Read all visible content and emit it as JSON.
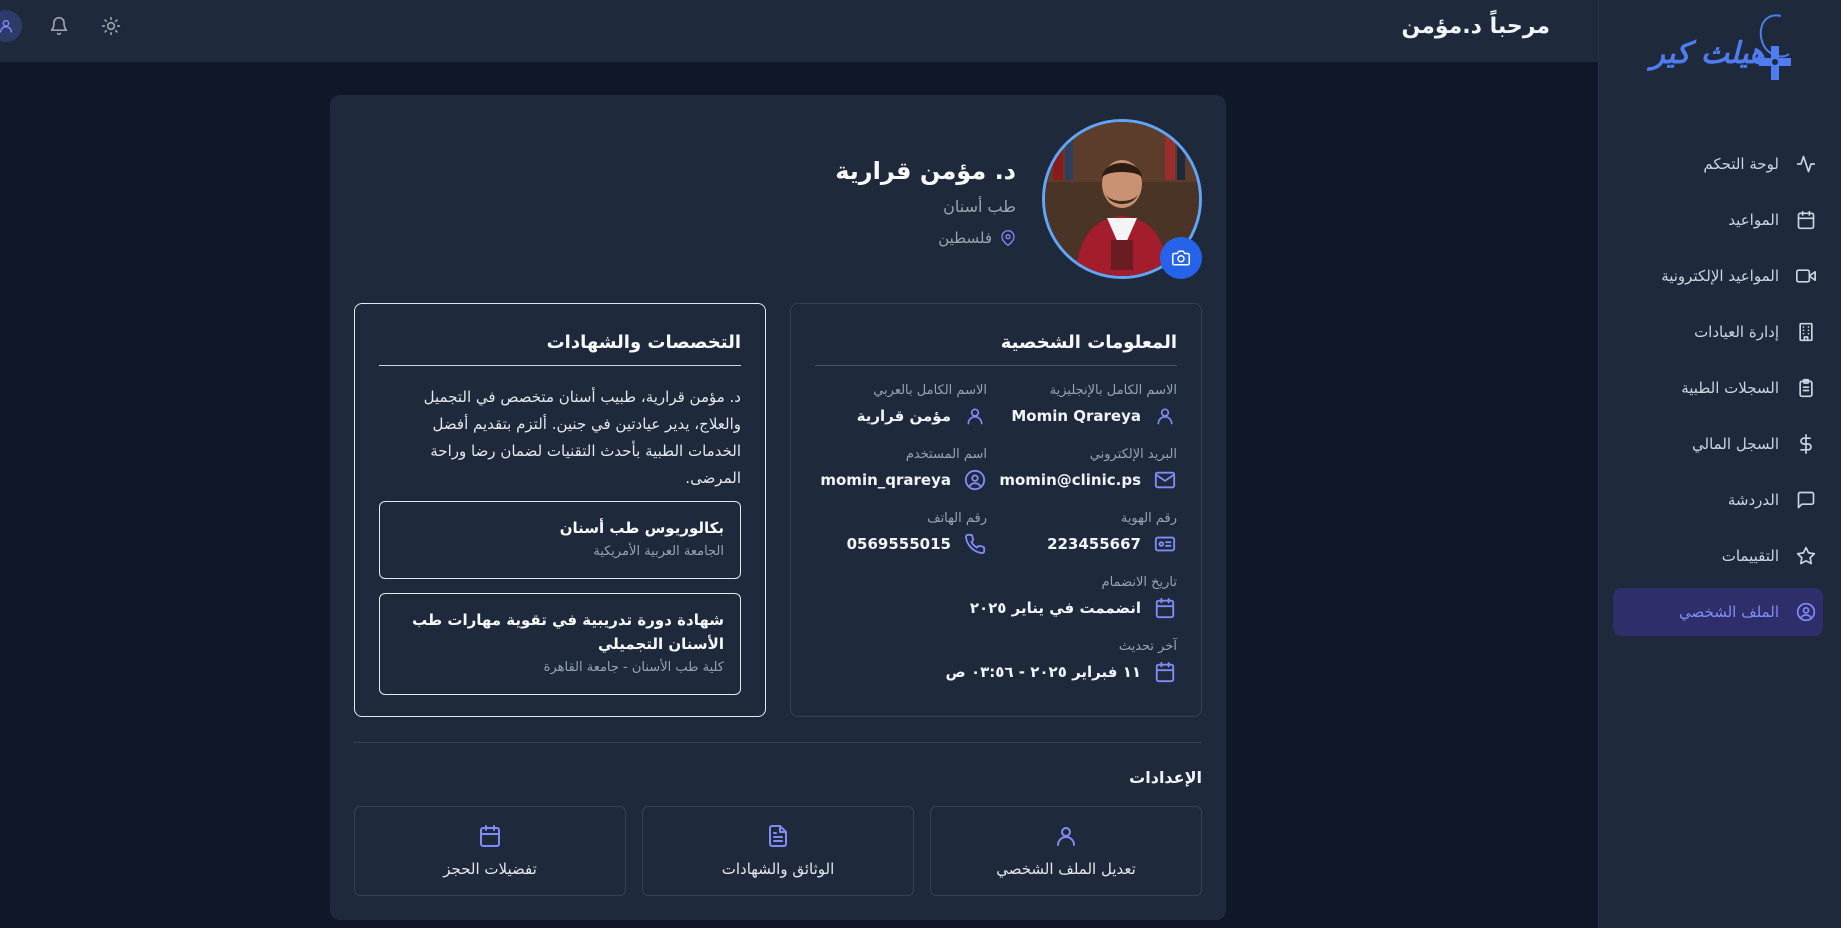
{
  "sidebar": {
    "logo_text": "هيلث كير",
    "items": [
      {
        "label": "لوحة التحكم",
        "icon": "activity-icon"
      },
      {
        "label": "المواعيد",
        "icon": "calendar-icon"
      },
      {
        "label": "المواعيد الإلكترونية",
        "icon": "video-icon"
      },
      {
        "label": "إدارة العيادات",
        "icon": "building-icon"
      },
      {
        "label": "السجلات الطبية",
        "icon": "clipboard-icon"
      },
      {
        "label": "السجل المالي",
        "icon": "dollar-icon"
      },
      {
        "label": "الدردشة",
        "icon": "chat-icon"
      },
      {
        "label": "التقييمات",
        "icon": "star-icon"
      },
      {
        "label": "الملف الشخصي",
        "icon": "user-circle-icon",
        "active": true
      }
    ]
  },
  "topbar": {
    "welcome": "مرحباً د.مؤمن"
  },
  "profile": {
    "name": "د. مؤمن قرارية",
    "specialty": "طب أسنان",
    "location": "فلسطين"
  },
  "personal": {
    "title": "المعلومات الشخصية",
    "name_en_label": "الاسم الكامل بالإنجليزية",
    "name_en": "Momin Qrareya",
    "name_ar_label": "الاسم الكامل بالعربي",
    "name_ar": "مؤمن قرارية",
    "email_label": "البريد الإلكتروني",
    "email": "momin@clinic.ps",
    "username_label": "اسم المستخدم",
    "username": "momin_qrareya",
    "id_label": "رقم الهوية",
    "id": "223455667",
    "phone_label": "رقم الهاتف",
    "phone": "0569555015",
    "joined_label": "تاريخ الانضمام",
    "joined": "انضممت في يناير ٢٠٢٥",
    "updated_label": "آخر تحديث",
    "updated": "١١ فبراير ٢٠٢٥ - ٠٣:٥٦ ص"
  },
  "specialties": {
    "title": "التخصصات والشهادات",
    "bio": "د. مؤمن قرارية، طبيب أسنان متخصص في التجميل والعلاج، يدير عيادتين في جنين. ألتزم بتقديم أفضل الخدمات الطبية بأحدث التقنيات لضمان رضا وراحة المرضى.",
    "certs": [
      {
        "title": "بكالوريوس طب أسنان",
        "subtitle": "الجامعة العربية الأمريكية"
      },
      {
        "title": "شهادة دورة تدريبية في تقوية مهارات طب الأسنان التجميلي",
        "subtitle": "كلية طب الأسنان - جامعة القاهرة"
      }
    ]
  },
  "settings": {
    "title": "الإعدادات",
    "edit_profile": "تعديل الملف الشخصي",
    "documents": "الوثائق والشهادات",
    "booking_prefs": "تفضيلات الحجز"
  },
  "colors": {
    "background": "#0f1729",
    "panel": "#1e293b",
    "accent": "#818cf8",
    "brand": "#4f7cf0",
    "camera_button": "#2563eb"
  }
}
